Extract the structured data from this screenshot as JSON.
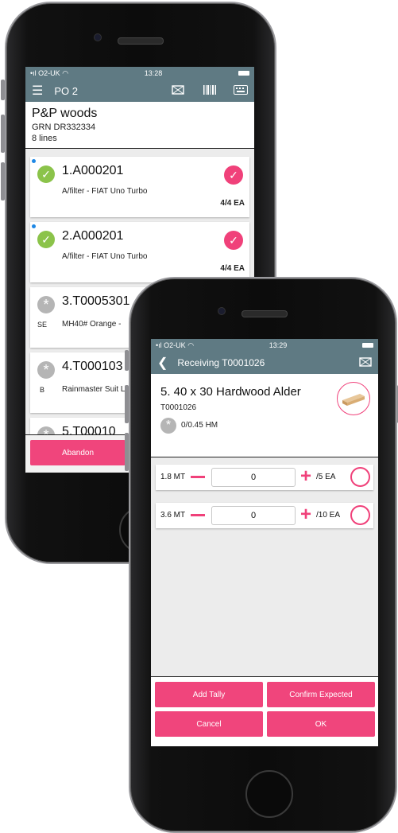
{
  "back": {
    "status": {
      "carrier": "O2-UK",
      "time": "13:28"
    },
    "toolbar": {
      "title": "PO 2"
    },
    "header": {
      "supplier": "P&P woods",
      "grn": "GRN DR332334",
      "lines": "8 lines"
    },
    "items": [
      {
        "title": "1.A000201",
        "desc": "A/filter - FIAT Uno Turbo",
        "qty": "4/4 EA",
        "prefix": "",
        "status": "done"
      },
      {
        "title": "2.A000201",
        "desc": "A/filter - FIAT Uno Turbo",
        "qty": "4/4 EA",
        "prefix": "",
        "status": "done"
      },
      {
        "title": "3.T0005301",
        "desc": "MH40# Orange -",
        "qty": "",
        "prefix": "SE",
        "status": "pending"
      },
      {
        "title": "4.T000103",
        "desc": "Rainmaster Suit L",
        "qty": "",
        "prefix": "B",
        "status": "pending"
      },
      {
        "title": "5.T00010",
        "desc": "",
        "qty": "",
        "prefix": "",
        "status": "pending"
      }
    ],
    "abandon_label": "Abandon"
  },
  "front": {
    "status": {
      "carrier": "O2-UK",
      "time": "13:29"
    },
    "toolbar": {
      "title": "Receiving T0001026"
    },
    "product": {
      "title": "5. 40 x 30 Hardwood Alder",
      "code": "T0001026",
      "progress": "0/0.45 HM"
    },
    "tally": [
      {
        "length": "1.8 MT",
        "value": "0",
        "expected": "/5 EA"
      },
      {
        "length": "3.6 MT",
        "value": "0",
        "expected": "/10 EA"
      }
    ],
    "buttons": {
      "add_tally": "Add Tally",
      "confirm_expected": "Confirm Expected",
      "cancel": "Cancel",
      "ok": "OK"
    }
  },
  "colors": {
    "toolbar": "#5f7a83",
    "accent": "#f0417a",
    "done": "#8bc34a"
  }
}
